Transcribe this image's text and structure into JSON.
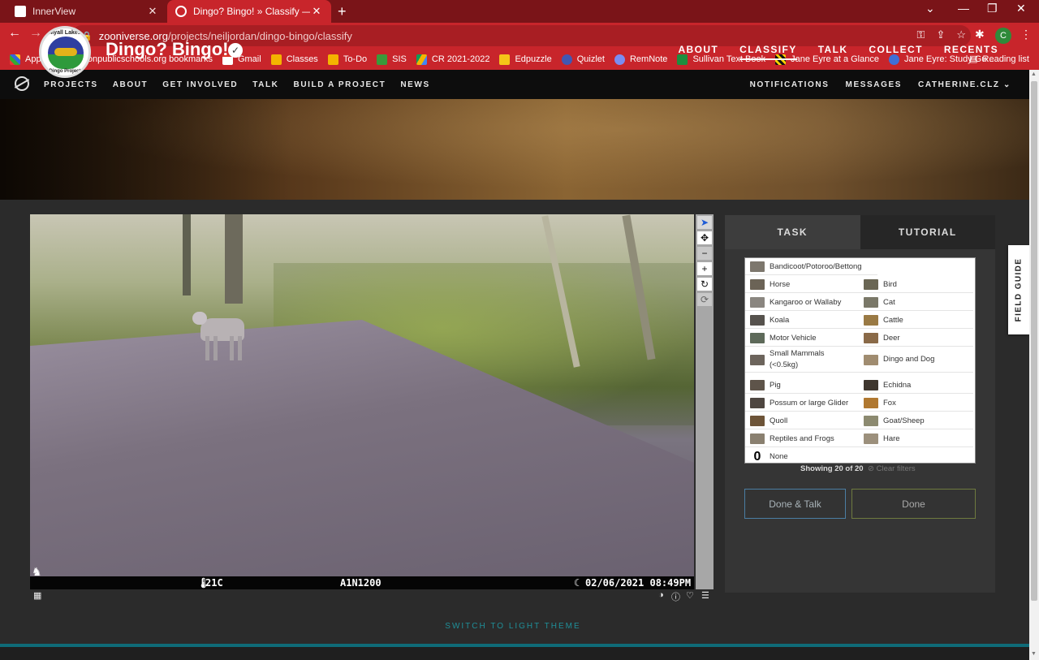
{
  "browser": {
    "tabs": [
      {
        "title": "InnerView",
        "active": false
      },
      {
        "title": "Dingo? Bingo! » Classify — Zooniverse",
        "active": true
      }
    ],
    "url_host": "zooniverse.org",
    "url_path": "/projects/neiljordan/dingo-bingo/classify",
    "profile_initial": "C",
    "bookmarks": [
      "Apps",
      "bostonpublicschools.org bookmarks",
      "Gmail",
      "Classes",
      "To-Do",
      "SIS",
      "CR 2021-2022",
      "Edpuzzle",
      "Quizlet",
      "RemNote",
      "Sullivan Text Book",
      "Jane Eyre at a Glance",
      "Jane Eyre: Study Gu..."
    ],
    "reading_list": "Reading list"
  },
  "site_nav": {
    "links": [
      "PROJECTS",
      "ABOUT",
      "GET INVOLVED",
      "TALK",
      "BUILD A PROJECT",
      "NEWS"
    ],
    "right": [
      "NOTIFICATIONS",
      "MESSAGES",
      "CATHERINE.CLZ"
    ]
  },
  "project": {
    "badge_top": "Myall Lakes",
    "badge_bottom": "Dingo Project",
    "title": "Dingo? Bingo!",
    "nav": [
      "ABOUT",
      "CLASSIFY",
      "TALK",
      "COLLECT",
      "RECENTS"
    ],
    "active_nav": "CLASSIFY"
  },
  "camera_strip": {
    "temp": "21C",
    "camera_id": "A1N1200",
    "datetime": "02/06/2021 08:49PM"
  },
  "task": {
    "tabs": [
      "TASK",
      "TUTORIAL"
    ],
    "choices_left": [
      "Bandicoot/Potoroo/Bettong",
      "Horse",
      "Kangaroo or Wallaby",
      "Koala",
      "Motor Vehicle",
      "Small Mammals (<0.5kg)",
      "Pig",
      "Possum or large Glider",
      "Quoll",
      "Reptiles and Frogs",
      "None"
    ],
    "choices_right": [
      "Bird",
      "Cat",
      "Cattle",
      "Deer",
      "Dingo and Dog",
      "Echidna",
      "Fox",
      "Goat/Sheep",
      "Hare"
    ],
    "showing": "Showing 20 of 20",
    "clear_filters": "Clear filters",
    "done_talk": "Done & Talk",
    "done": "Done"
  },
  "field_guide": "FIELD GUIDE",
  "switch_theme": "SWITCH TO LIGHT THEME"
}
